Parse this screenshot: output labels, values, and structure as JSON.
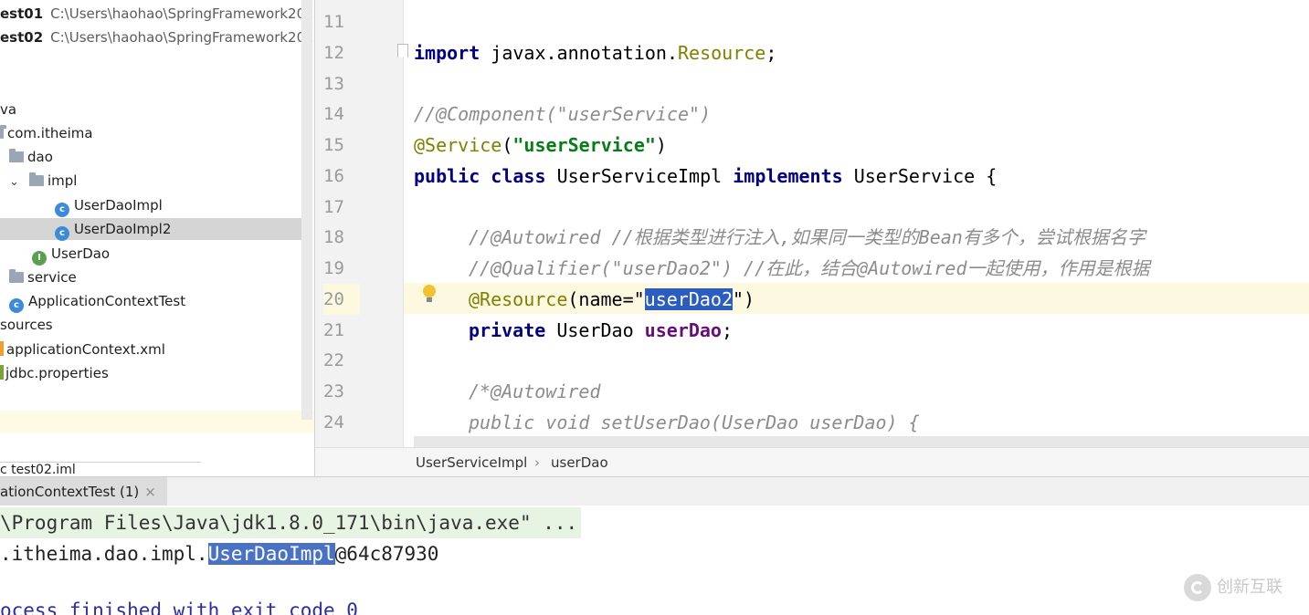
{
  "tree": {
    "modules": [
      {
        "name": "est01",
        "path": "C:\\Users\\haohao\\SpringFramework2023\\s"
      },
      {
        "name": "est02",
        "path": "C:\\Users\\haohao\\SpringFramework2023\\s"
      }
    ],
    "java_folder": "va",
    "package": "com.itheima",
    "dao": "dao",
    "impl": "impl",
    "class1": "UserDaoImpl",
    "class2": "UserDaoImpl2",
    "interface1": "UserDao",
    "service": "service",
    "test_class": "ApplicationContextTest",
    "resources": "sources",
    "xml_file": "applicationContext.xml",
    "props_file": "jdbc.properties",
    "iml_file": "c  test02.iml"
  },
  "editor": {
    "line_numbers": [
      "11",
      "12",
      "13",
      "14",
      "15",
      "16",
      "17",
      "18",
      "19",
      "20",
      "21",
      "22",
      "23",
      "24"
    ],
    "line12": {
      "kw": "import",
      "pkg": " javax.annotation.",
      "cls": "Resource",
      "end": ";"
    },
    "line14": "//@Component(\"userService\")",
    "line15": {
      "ann": "@Service",
      "open": "(",
      "str": "\"userService\"",
      "close": ")"
    },
    "line16": {
      "kw1": "public",
      "kw2": "class",
      "name": "UserServiceImpl",
      "kw3": "implements",
      "iface": "UserService {"
    },
    "line18": "//@Autowired //根据类型进行注入,如果同一类型的Bean有多个，尝试根据名字",
    "line19": "//@Qualifier(\"userDao2\") //在此，结合@Autowired一起使用，作用是根据",
    "line20": {
      "ann": "@Resource",
      "open": "(name=\"",
      "selected": "userDao2",
      "close": "\")"
    },
    "line21": {
      "kw": "private",
      "type": " UserDao ",
      "field": "userDao",
      "end": ";"
    },
    "line23": "/*@Autowired",
    "line24": "public void setUserDao(UserDao userDao) {"
  },
  "breadcrumb": {
    "class": "UserServiceImpl",
    "separator": "›",
    "member": "userDao"
  },
  "run": {
    "tab_label": "ationContextTest (1)",
    "close": "×",
    "console_line1": "\\Program Files\\Java\\jdk1.8.0_171\\bin\\java.exe\" ...",
    "console_line2_prefix": ".itheima.dao.impl.",
    "console_line2_selected": "UserDaoImpl",
    "console_line2_suffix": "@64c87930",
    "console_line3": "ocess finished with exit code 0"
  },
  "watermark": {
    "text": "创新互联"
  },
  "colors": {
    "selection": "#2b5cbf",
    "string": "#067d17",
    "keyword": "#000080",
    "annotation": "#808000",
    "comment": "#8c8c8c"
  }
}
